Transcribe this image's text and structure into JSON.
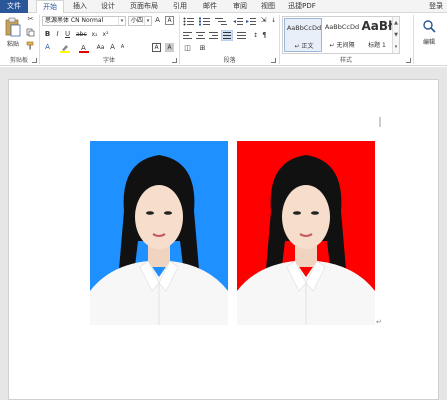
{
  "tabs": [
    {
      "label": "文件",
      "type": "file"
    },
    {
      "label": "开始",
      "type": "active"
    },
    {
      "label": "插入",
      "type": "normal"
    },
    {
      "label": "设计",
      "type": "normal"
    },
    {
      "label": "页面布局",
      "type": "normal"
    },
    {
      "label": "引用",
      "type": "normal"
    },
    {
      "label": "邮件",
      "type": "normal"
    },
    {
      "label": "审阅",
      "type": "normal"
    },
    {
      "label": "视图",
      "type": "normal"
    },
    {
      "label": "迅捷PDF",
      "type": "normal"
    }
  ],
  "login_label": "登录",
  "clipboard": {
    "paste_label": "粘贴",
    "group_label": "剪贴板"
  },
  "font": {
    "name": "思源黑体 CN Normal",
    "size": "小四",
    "group_label": "字体"
  },
  "paragraph": {
    "group_label": "段落"
  },
  "styles": {
    "group_label": "样式",
    "items": [
      {
        "preview": "AaBbCcDd",
        "name": "↵ 正文",
        "selected": true
      },
      {
        "preview": "AaBbCcDd",
        "name": "↵ 无间隔",
        "selected": false
      },
      {
        "preview": "AaBł",
        "name": "标题 1",
        "selected": false
      }
    ]
  },
  "editing": {
    "label": "编辑"
  },
  "photos": [
    {
      "background": "#1e90ff",
      "label": "blue-background-id-photo"
    },
    {
      "background": "#ff0000",
      "label": "red-background-id-photo"
    }
  ],
  "colors": {
    "accent": "#2b579a",
    "font_red": "#e00000",
    "highlight": "#ffff00"
  }
}
